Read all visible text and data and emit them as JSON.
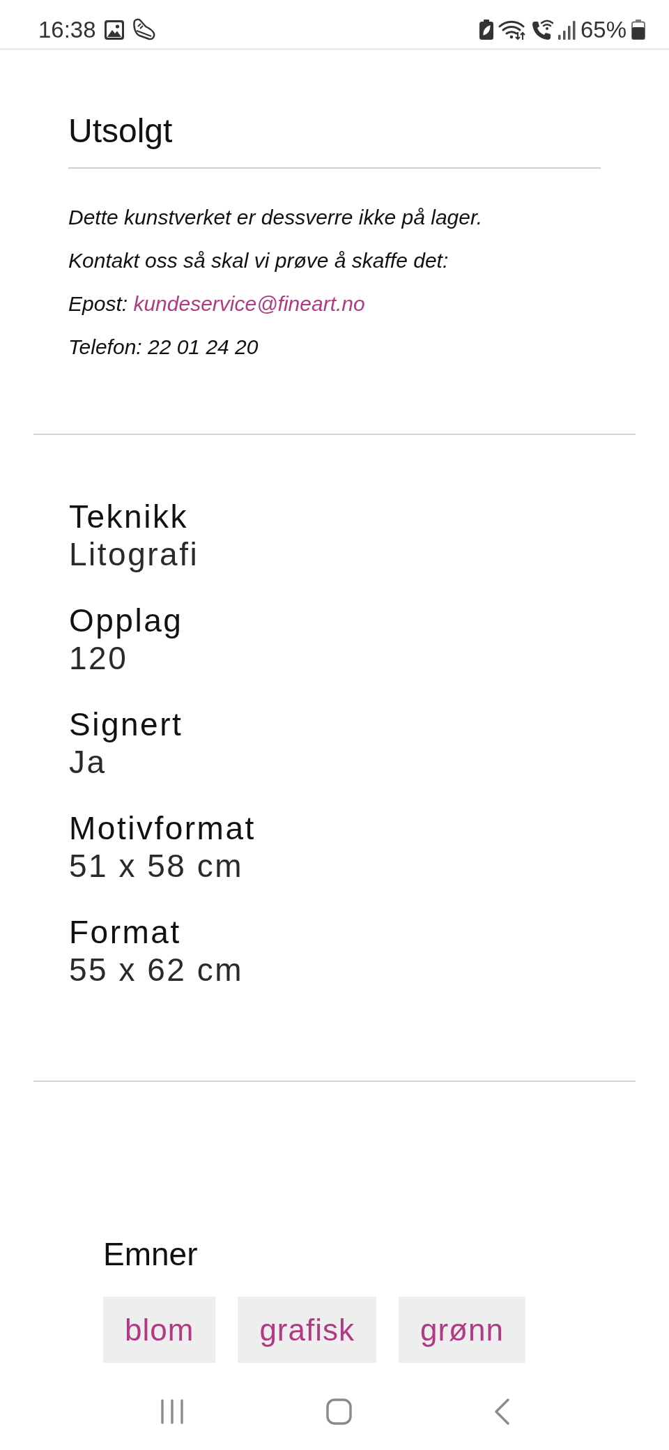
{
  "status_bar": {
    "time": "16:38",
    "battery": "65%"
  },
  "stock_notice": {
    "title": "Utsolgt",
    "lines": [
      {
        "kind": "text",
        "text": "Dette kunstverket er dessverre ikke på lager."
      },
      {
        "kind": "text",
        "text": "Kontakt oss så skal vi prøve å skaffe det:"
      },
      {
        "kind": "email",
        "label": "Epost:",
        "link": "kundeservice@fineart.no"
      },
      {
        "kind": "text",
        "text": "Telefon: 22 01 24 20"
      }
    ]
  },
  "details": [
    {
      "label": "Teknikk",
      "value": "Litografi"
    },
    {
      "label": "Opplag",
      "value": "120"
    },
    {
      "label": "Signert",
      "value": "Ja"
    },
    {
      "label": "Motivformat",
      "value": "51 x 58 cm"
    },
    {
      "label": "Format",
      "value": "55 x 62 cm"
    }
  ],
  "topics": {
    "title": "Emner",
    "tags": [
      "blom",
      "grafisk",
      "grønn"
    ]
  }
}
